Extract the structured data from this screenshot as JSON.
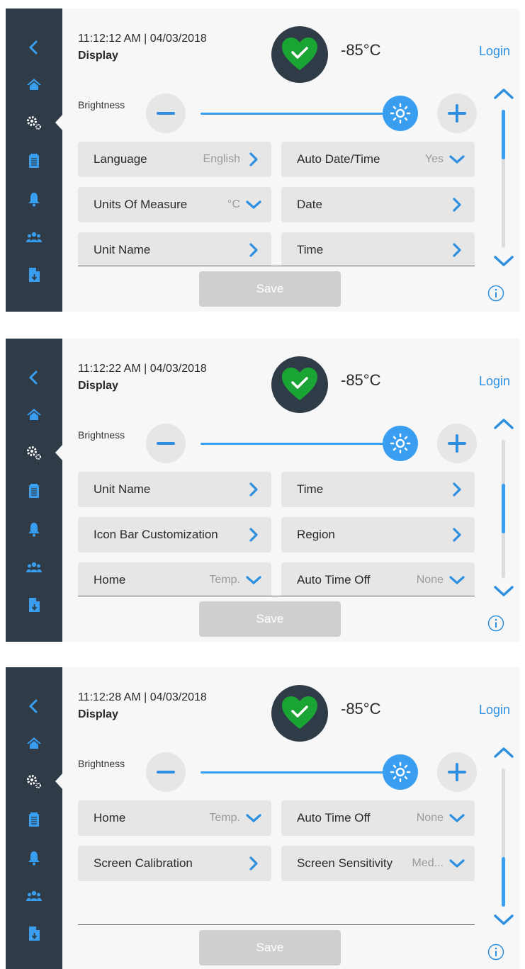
{
  "screens": [
    {
      "time": "11:12:12 AM | 04/03/2018",
      "title": "Display",
      "temperature": "-85°C",
      "login": "Login",
      "brightness_label": "Brightness",
      "brightness_level": 1.0,
      "save_label": "Save",
      "scroll_position": "top",
      "tiles": [
        {
          "label": "Language",
          "value": "English",
          "icon": "chevron-right-icon"
        },
        {
          "label": "Auto Date/Time",
          "value": "Yes",
          "icon": "chevron-down-icon"
        },
        {
          "label": "Units Of Measure",
          "value": "°C",
          "icon": "chevron-down-icon"
        },
        {
          "label": "Date",
          "value": "",
          "icon": "chevron-right-icon"
        },
        {
          "label": "Unit Name",
          "value": "",
          "icon": "chevron-right-icon"
        },
        {
          "label": "Time",
          "value": "",
          "icon": "chevron-right-icon"
        }
      ]
    },
    {
      "time": "11:12:22 AM | 04/03/2018",
      "title": "Display",
      "temperature": "-85°C",
      "login": "Login",
      "brightness_label": "Brightness",
      "brightness_level": 1.0,
      "save_label": "Save",
      "scroll_position": "middle",
      "tiles": [
        {
          "label": "Unit Name",
          "value": "",
          "icon": "chevron-right-icon"
        },
        {
          "label": "Time",
          "value": "",
          "icon": "chevron-right-icon"
        },
        {
          "label": "Icon Bar Customization",
          "value": "",
          "icon": "chevron-right-icon"
        },
        {
          "label": "Region",
          "value": "",
          "icon": "chevron-right-icon"
        },
        {
          "label": "Home",
          "value": "Temp.",
          "icon": "chevron-down-icon"
        },
        {
          "label": "Auto Time Off",
          "value": "None",
          "icon": "chevron-down-icon"
        }
      ]
    },
    {
      "time": "11:12:28 AM | 04/03/2018",
      "title": "Display",
      "temperature": "-85°C",
      "login": "Login",
      "brightness_label": "Brightness",
      "brightness_level": 1.0,
      "save_label": "Save",
      "scroll_position": "bottom",
      "tiles": [
        {
          "label": "Home",
          "value": "Temp.",
          "icon": "chevron-down-icon"
        },
        {
          "label": "Auto Time Off",
          "value": "None",
          "icon": "chevron-down-icon"
        },
        {
          "label": "Screen Calibration",
          "value": "",
          "icon": "chevron-right-icon"
        },
        {
          "label": "Screen Sensitivity",
          "value": "Med...",
          "icon": "chevron-down-icon"
        }
      ]
    }
  ],
  "sidebar": [
    "back-icon",
    "home-icon",
    "settings-icon",
    "clipboard-icon",
    "bell-icon",
    "users-icon",
    "file-download-icon"
  ],
  "colors": {
    "accent": "#3a9ef0",
    "sidebar": "#2f3c47",
    "tile": "#e6e6e6",
    "heart": "#1aa434",
    "save_disabled": "#cfcfcf"
  }
}
